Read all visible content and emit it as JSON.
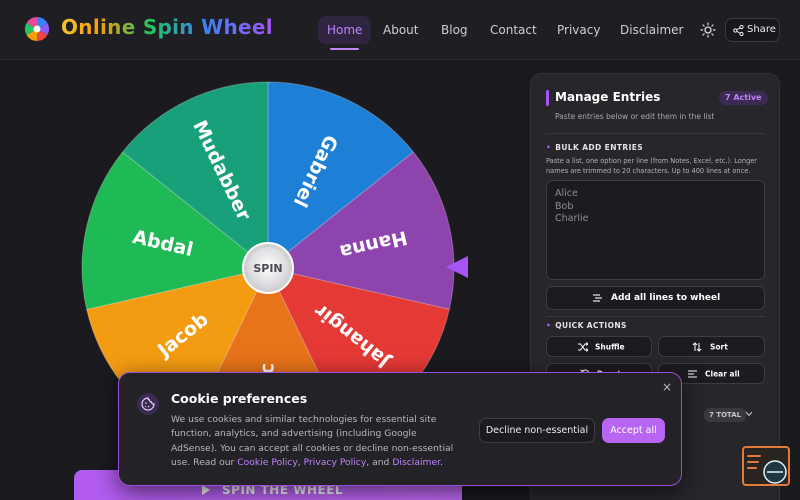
{
  "header": {
    "app_title": "Online Spin Wheel",
    "nav": [
      {
        "label": "Home",
        "active": true
      },
      {
        "label": "About",
        "active": false
      },
      {
        "label": "Blog",
        "active": false
      },
      {
        "label": "Contact",
        "active": false
      },
      {
        "label": "Privacy",
        "active": false
      },
      {
        "label": "Disclaimer",
        "active": false
      }
    ],
    "theme_icon": "sun-icon",
    "share_label": "Share"
  },
  "wheel": {
    "center_label": "SPIN",
    "segments": [
      {
        "label": "Gabriel",
        "color": "#1d7fd6"
      },
      {
        "label": "Hanna",
        "color": "#8e44ad"
      },
      {
        "label": "Jahangir",
        "color": "#e53935"
      },
      {
        "label": "Ac",
        "color": "#e8731a"
      },
      {
        "label": "Jacob",
        "color": "#f39c12"
      },
      {
        "label": "Abdal",
        "color": "#1fb955"
      },
      {
        "label": "Mudabber",
        "color": "#17a07a"
      }
    ],
    "spin_button_label": "SPIN THE WHEEL"
  },
  "panel": {
    "title": "Manage Entries",
    "active_badge": "7 Active",
    "subtitle": "Paste entries below or edit them in the list",
    "bulk_label": "BULK ADD ENTRIES",
    "bulk_help": "Paste a list, one option per line (from Notes, Excel, etc.). Longer names are trimmed to 20 characters. Up to 400 lines at once.",
    "entries_placeholder": "Alice\nBob\nCharlie",
    "add_all_label": "Add all lines to wheel",
    "quick_actions_label": "QUICK ACTIONS",
    "shuffle_label": "Shuffle",
    "sort_label": "Sort",
    "reset_label": "Reset",
    "clear_all_label": "Clear all",
    "total_badge": "7 TOTAL"
  },
  "cookie": {
    "title": "Cookie preferences",
    "body_text": "We use cookies and similar technologies for essential site function, analytics, and advertising (including Google AdSense). You can accept all cookies or decline non-essential use. Read our",
    "link_cookie_policy": "Cookie Policy",
    "sep_comma": ",",
    "link_privacy_policy": "Privacy Policy",
    "sep_and": ", and",
    "link_disclaimer": "Disclaimer",
    "end_period": ".",
    "decline_label": "Decline non-essential",
    "accept_label": "Accept all",
    "close_glyph": "×"
  },
  "colors": {
    "accent": "#a855f7",
    "background": "#1b1a1e",
    "panel": "#27262b"
  }
}
